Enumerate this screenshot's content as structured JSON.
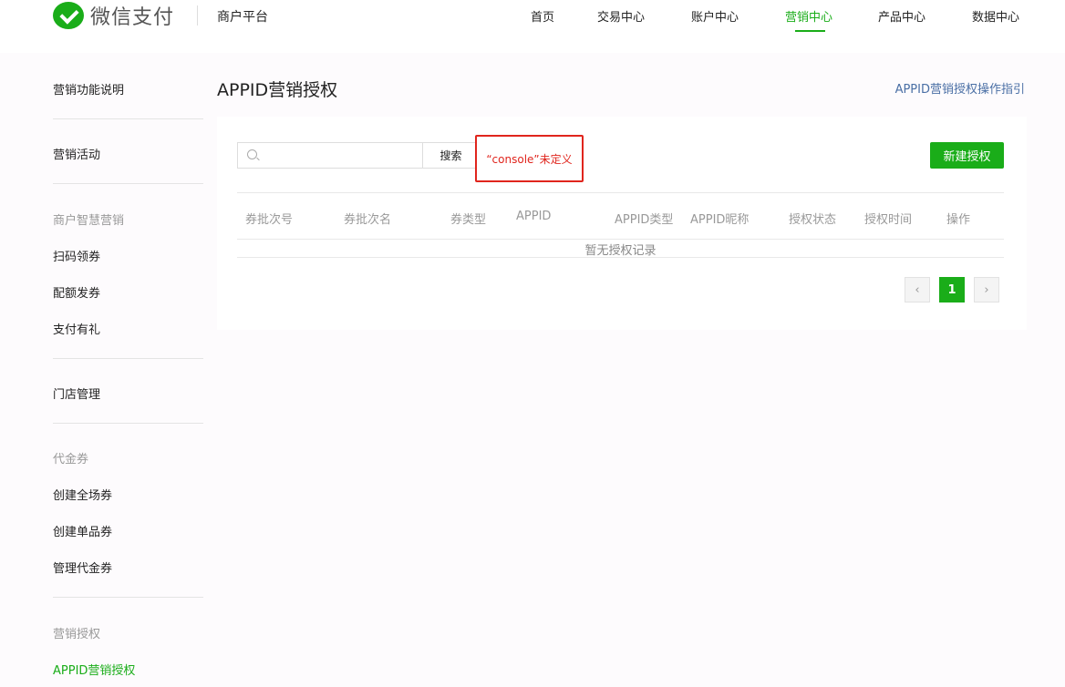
{
  "header": {
    "brand": "微信支付",
    "platform": "商户平台",
    "nav": [
      {
        "label": "首页",
        "active": false
      },
      {
        "label": "交易中心",
        "active": false
      },
      {
        "label": "账户中心",
        "active": false
      },
      {
        "label": "营销中心",
        "active": true
      },
      {
        "label": "产品中心",
        "active": false
      },
      {
        "label": "数据中心",
        "active": false
      }
    ],
    "accent_color": "#1aad19"
  },
  "sidebar": {
    "items": [
      {
        "label": "营销功能说明"
      },
      {
        "label": "营销活动"
      },
      {
        "label": "商户智慧营销"
      },
      {
        "label": "扫码领券"
      },
      {
        "label": "配额发券"
      },
      {
        "label": "支付有礼"
      },
      {
        "label": "门店管理"
      },
      {
        "label": "代金券"
      },
      {
        "label": "创建全场券"
      },
      {
        "label": "创建单品券"
      },
      {
        "label": "管理代金券"
      },
      {
        "label": "营销授权"
      },
      {
        "label": "APPID营销授权"
      }
    ]
  },
  "main": {
    "title": "APPID营销授权",
    "guide_link": "APPID营销授权操作指引",
    "search": {
      "value": "",
      "placeholder": "",
      "button": "搜索"
    },
    "error": "“console”未定义",
    "new_button": "新建授权",
    "table": {
      "columns": [
        "券批次号",
        "券批次名",
        "券类型",
        "APPID",
        "APPID类型",
        "APPID昵称",
        "授权状态",
        "授权时间",
        "操作"
      ],
      "empty_text": "暂无授权记录"
    },
    "pagination": {
      "prev": "‹",
      "current": "1",
      "next": "›"
    },
    "error_color": "#e0251d"
  }
}
